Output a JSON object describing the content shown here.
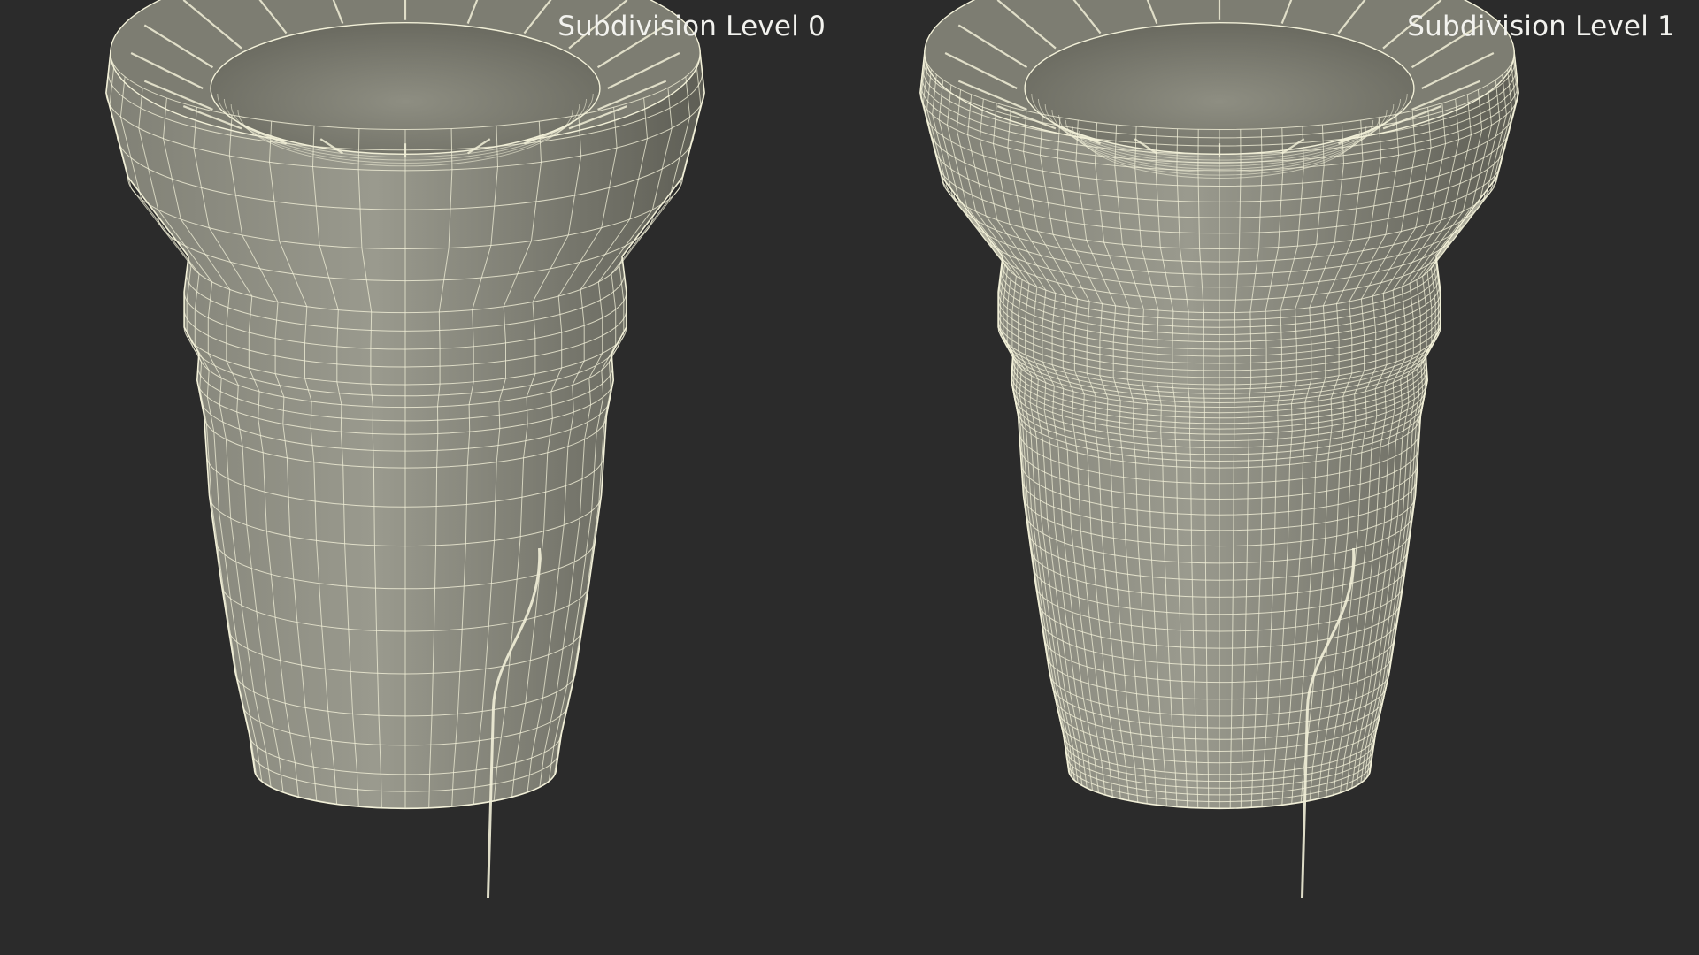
{
  "viewports": [
    {
      "label": "Subdivision Level 0",
      "subdivision_level": 0,
      "wire_density": "low"
    },
    {
      "label": "Subdivision Level 1",
      "subdivision_level": 1,
      "wire_density": "high"
    }
  ],
  "colors": {
    "background": "#2b2b2b",
    "mesh_surface": "#8a8a7e",
    "mesh_shadow": "#5e5e55",
    "wireframe": "#f2f0d8",
    "label_text": "#f2f2ee"
  }
}
